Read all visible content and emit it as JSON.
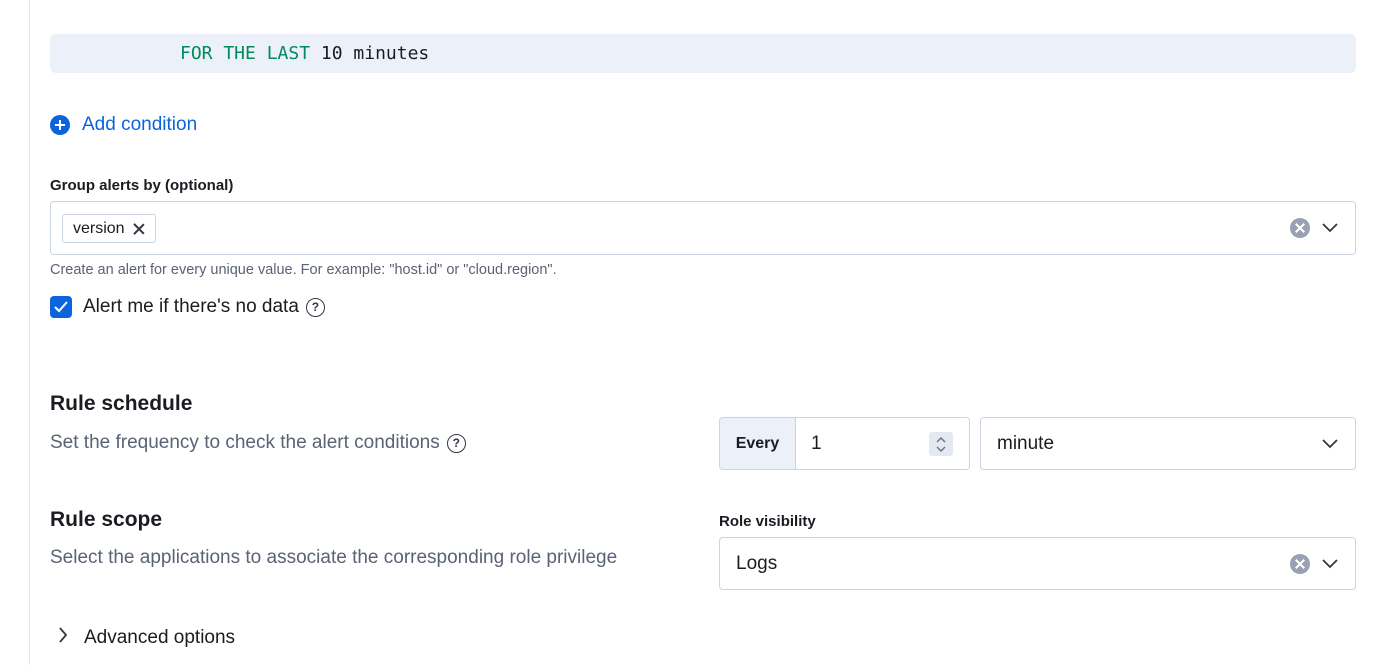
{
  "query": {
    "keyword": "FOR THE LAST",
    "value": "10 minutes"
  },
  "add_condition": {
    "label": "Add condition",
    "icon": "plus-circle-icon"
  },
  "group_by": {
    "label": "Group alerts by (optional)",
    "selected": [
      "version"
    ],
    "help": "Create an alert for every unique value. For example: \"host.id\" or \"cloud.region\"."
  },
  "no_data": {
    "label": "Alert me if there's no data",
    "checked": true
  },
  "rule_schedule": {
    "title": "Rule schedule",
    "description": "Set the frequency to check the alert conditions",
    "prefix": "Every",
    "interval_value": "1",
    "interval_unit": "minute"
  },
  "rule_scope": {
    "title": "Rule scope",
    "description": "Select the applications to associate the corresponding role privilege",
    "field_label": "Role visibility",
    "value": "Logs"
  },
  "advanced": {
    "label": "Advanced options"
  },
  "colors": {
    "primary": "#0b64dd",
    "keyword": "#008a5e",
    "muted_text": "#5a6275",
    "border": "#cad3e2",
    "code_bg": "#ecf1f9"
  }
}
